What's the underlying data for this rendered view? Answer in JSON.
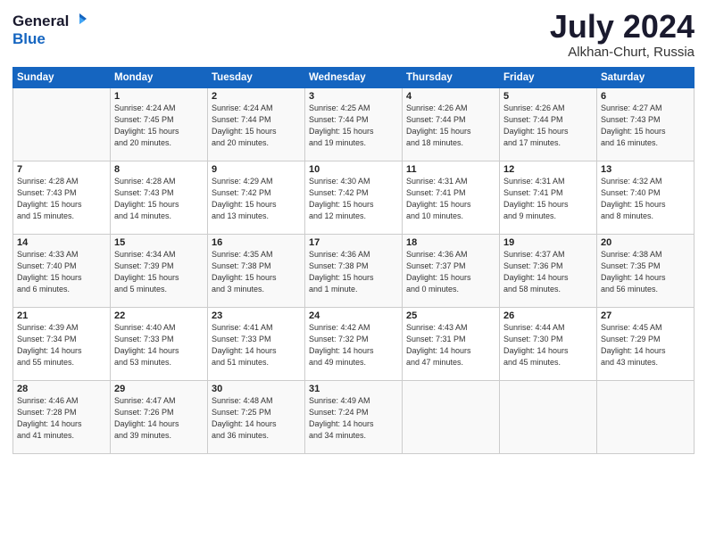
{
  "header": {
    "logo_general": "General",
    "logo_blue": "Blue",
    "month_year": "July 2024",
    "location": "Alkhan-Churt, Russia"
  },
  "days_of_week": [
    "Sunday",
    "Monday",
    "Tuesday",
    "Wednesday",
    "Thursday",
    "Friday",
    "Saturday"
  ],
  "weeks": [
    [
      {
        "day": "",
        "info": ""
      },
      {
        "day": "1",
        "info": "Sunrise: 4:24 AM\nSunset: 7:45 PM\nDaylight: 15 hours\nand 20 minutes."
      },
      {
        "day": "2",
        "info": "Sunrise: 4:24 AM\nSunset: 7:44 PM\nDaylight: 15 hours\nand 20 minutes."
      },
      {
        "day": "3",
        "info": "Sunrise: 4:25 AM\nSunset: 7:44 PM\nDaylight: 15 hours\nand 19 minutes."
      },
      {
        "day": "4",
        "info": "Sunrise: 4:26 AM\nSunset: 7:44 PM\nDaylight: 15 hours\nand 18 minutes."
      },
      {
        "day": "5",
        "info": "Sunrise: 4:26 AM\nSunset: 7:44 PM\nDaylight: 15 hours\nand 17 minutes."
      },
      {
        "day": "6",
        "info": "Sunrise: 4:27 AM\nSunset: 7:43 PM\nDaylight: 15 hours\nand 16 minutes."
      }
    ],
    [
      {
        "day": "7",
        "info": "Sunrise: 4:28 AM\nSunset: 7:43 PM\nDaylight: 15 hours\nand 15 minutes."
      },
      {
        "day": "8",
        "info": "Sunrise: 4:28 AM\nSunset: 7:43 PM\nDaylight: 15 hours\nand 14 minutes."
      },
      {
        "day": "9",
        "info": "Sunrise: 4:29 AM\nSunset: 7:42 PM\nDaylight: 15 hours\nand 13 minutes."
      },
      {
        "day": "10",
        "info": "Sunrise: 4:30 AM\nSunset: 7:42 PM\nDaylight: 15 hours\nand 12 minutes."
      },
      {
        "day": "11",
        "info": "Sunrise: 4:31 AM\nSunset: 7:41 PM\nDaylight: 15 hours\nand 10 minutes."
      },
      {
        "day": "12",
        "info": "Sunrise: 4:31 AM\nSunset: 7:41 PM\nDaylight: 15 hours\nand 9 minutes."
      },
      {
        "day": "13",
        "info": "Sunrise: 4:32 AM\nSunset: 7:40 PM\nDaylight: 15 hours\nand 8 minutes."
      }
    ],
    [
      {
        "day": "14",
        "info": "Sunrise: 4:33 AM\nSunset: 7:40 PM\nDaylight: 15 hours\nand 6 minutes."
      },
      {
        "day": "15",
        "info": "Sunrise: 4:34 AM\nSunset: 7:39 PM\nDaylight: 15 hours\nand 5 minutes."
      },
      {
        "day": "16",
        "info": "Sunrise: 4:35 AM\nSunset: 7:38 PM\nDaylight: 15 hours\nand 3 minutes."
      },
      {
        "day": "17",
        "info": "Sunrise: 4:36 AM\nSunset: 7:38 PM\nDaylight: 15 hours\nand 1 minute."
      },
      {
        "day": "18",
        "info": "Sunrise: 4:36 AM\nSunset: 7:37 PM\nDaylight: 15 hours\nand 0 minutes."
      },
      {
        "day": "19",
        "info": "Sunrise: 4:37 AM\nSunset: 7:36 PM\nDaylight: 14 hours\nand 58 minutes."
      },
      {
        "day": "20",
        "info": "Sunrise: 4:38 AM\nSunset: 7:35 PM\nDaylight: 14 hours\nand 56 minutes."
      }
    ],
    [
      {
        "day": "21",
        "info": "Sunrise: 4:39 AM\nSunset: 7:34 PM\nDaylight: 14 hours\nand 55 minutes."
      },
      {
        "day": "22",
        "info": "Sunrise: 4:40 AM\nSunset: 7:33 PM\nDaylight: 14 hours\nand 53 minutes."
      },
      {
        "day": "23",
        "info": "Sunrise: 4:41 AM\nSunset: 7:33 PM\nDaylight: 14 hours\nand 51 minutes."
      },
      {
        "day": "24",
        "info": "Sunrise: 4:42 AM\nSunset: 7:32 PM\nDaylight: 14 hours\nand 49 minutes."
      },
      {
        "day": "25",
        "info": "Sunrise: 4:43 AM\nSunset: 7:31 PM\nDaylight: 14 hours\nand 47 minutes."
      },
      {
        "day": "26",
        "info": "Sunrise: 4:44 AM\nSunset: 7:30 PM\nDaylight: 14 hours\nand 45 minutes."
      },
      {
        "day": "27",
        "info": "Sunrise: 4:45 AM\nSunset: 7:29 PM\nDaylight: 14 hours\nand 43 minutes."
      }
    ],
    [
      {
        "day": "28",
        "info": "Sunrise: 4:46 AM\nSunset: 7:28 PM\nDaylight: 14 hours\nand 41 minutes."
      },
      {
        "day": "29",
        "info": "Sunrise: 4:47 AM\nSunset: 7:26 PM\nDaylight: 14 hours\nand 39 minutes."
      },
      {
        "day": "30",
        "info": "Sunrise: 4:48 AM\nSunset: 7:25 PM\nDaylight: 14 hours\nand 36 minutes."
      },
      {
        "day": "31",
        "info": "Sunrise: 4:49 AM\nSunset: 7:24 PM\nDaylight: 14 hours\nand 34 minutes."
      },
      {
        "day": "",
        "info": ""
      },
      {
        "day": "",
        "info": ""
      },
      {
        "day": "",
        "info": ""
      }
    ]
  ]
}
